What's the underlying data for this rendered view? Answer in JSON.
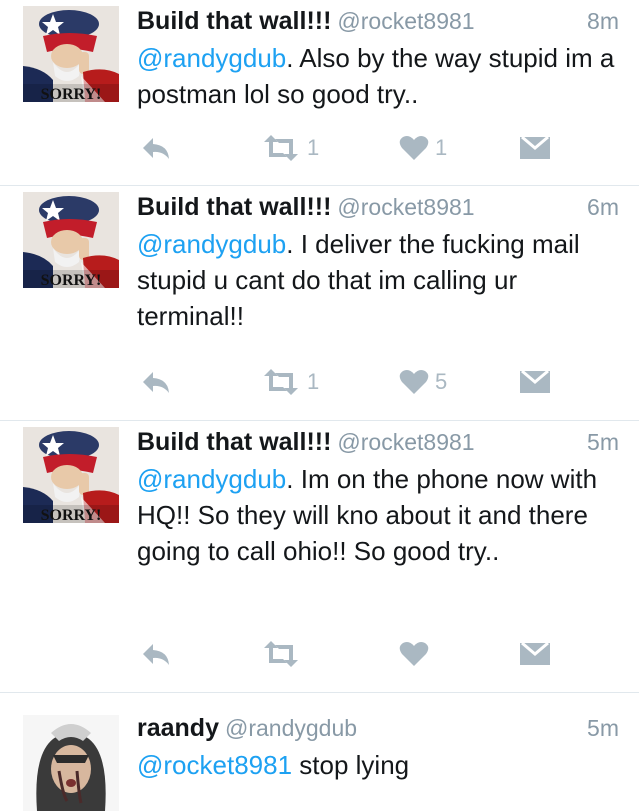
{
  "tweets": [
    {
      "name": "Build that wall!!!",
      "handle": "@rocket8981",
      "time": "8m",
      "mention": "@randygdub",
      "text": ". Also by the way stupid im a postman lol so good try..",
      "retweets": "1",
      "likes": "1",
      "avatar_caption": "SORRY!"
    },
    {
      "name": "Build that wall!!!",
      "handle": "@rocket8981",
      "time": "6m",
      "mention": "@randygdub",
      "text": ". I deliver the fucking mail stupid u cant do that im calling ur terminal!!",
      "retweets": "1",
      "likes": "5",
      "avatar_caption": "SORRY!"
    },
    {
      "name": "Build that wall!!!",
      "handle": "@rocket8981",
      "time": "5m",
      "mention": "@randygdub",
      "text": ". Im on the phone now with HQ!! So they will kno about it and there going to call ohio!! So good try..",
      "retweets": "",
      "likes": "",
      "avatar_caption": "SORRY!"
    },
    {
      "name": "raandy",
      "handle": "@randygdub",
      "time": "5m",
      "mention": "@rocket8981",
      "text": " stop lying"
    }
  ],
  "icons": {
    "reply": "reply-arrow-icon",
    "retweet": "retweet-icon",
    "like": "heart-icon",
    "dm": "envelope-icon"
  },
  "colors": {
    "link": "#1da1f2",
    "muted": "#8899a6",
    "icon": "#aab8c2",
    "divider": "#e1e8ed"
  }
}
